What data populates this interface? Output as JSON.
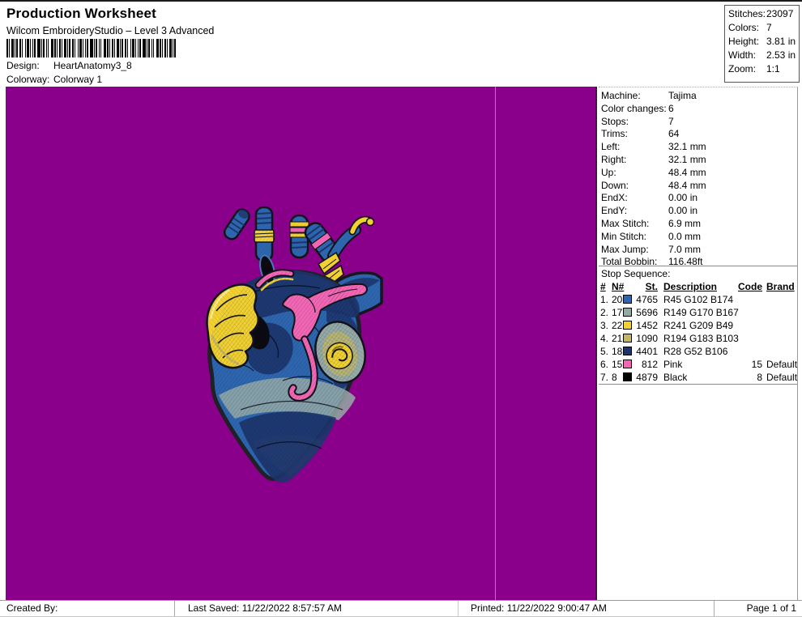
{
  "header": {
    "title": "Production Worksheet",
    "subtitle": "Wilcom EmbroideryStudio – Level 3 Advanced",
    "design_label": "Design:",
    "design_value": "HeartAnatomy3_8",
    "colorway_label": "Colorway:",
    "colorway_value": "Colorway 1",
    "barcode_icon": "barcode"
  },
  "summary": {
    "rows": [
      {
        "label": "Stitches:",
        "value": "23097"
      },
      {
        "label": "Colors:",
        "value": "7"
      },
      {
        "label": "Height:",
        "value": "3.81 in"
      },
      {
        "label": "Width:",
        "value": "2.53 in"
      },
      {
        "label": "Zoom:",
        "value": "1:1"
      }
    ]
  },
  "machine_info": {
    "rows": [
      {
        "label": "Machine:",
        "value": "Tajima"
      },
      {
        "label": "Color changes:",
        "value": "6"
      },
      {
        "label": "Stops:",
        "value": "7"
      },
      {
        "label": "Trims:",
        "value": "64"
      },
      {
        "label": "Left:",
        "value": "32.1 mm"
      },
      {
        "label": "Right:",
        "value": "32.1 mm"
      },
      {
        "label": "Up:",
        "value": "48.4 mm"
      },
      {
        "label": "Down:",
        "value": "48.4 mm"
      },
      {
        "label": "EndX:",
        "value": "0.00 in"
      },
      {
        "label": "EndY:",
        "value": "0.00 in"
      },
      {
        "label": "Max Stitch:",
        "value": "6.9 mm"
      },
      {
        "label": "Min Stitch:",
        "value": "0.0 mm"
      },
      {
        "label": "Max Jump:",
        "value": "7.0 mm"
      },
      {
        "label": "Total Bobbin:",
        "value": "116.48ft"
      }
    ]
  },
  "stop_sequence": {
    "title": "Stop Sequence:",
    "columns": [
      "#",
      "N#",
      "St.",
      "Description",
      "Code",
      "Brand"
    ],
    "rows": [
      {
        "num": "1.",
        "n": "20",
        "swatch": "#2D66AE",
        "st": "4765",
        "description": "R45 G102 B174",
        "code": "",
        "brand": ""
      },
      {
        "num": "2.",
        "n": "17",
        "swatch": "#95AAA7",
        "st": "5696",
        "description": "R149 G170 B167",
        "code": "",
        "brand": ""
      },
      {
        "num": "3.",
        "n": "22",
        "swatch": "#F1D131",
        "st": "1452",
        "description": "R241 G209 B49",
        "code": "",
        "brand": ""
      },
      {
        "num": "4.",
        "n": "21",
        "swatch": "#C2B767",
        "st": "1090",
        "description": "R194 G183 B103",
        "code": "",
        "brand": ""
      },
      {
        "num": "5.",
        "n": "18",
        "swatch": "#1C346A",
        "st": "4401",
        "description": "R28 G52 B106",
        "code": "",
        "brand": ""
      },
      {
        "num": "6.",
        "n": "15",
        "swatch": "#F266B4",
        "st": "812",
        "description": "Pink",
        "code": "15",
        "brand": "Default"
      },
      {
        "num": "7.",
        "n": "8",
        "swatch": "#000000",
        "st": "4879",
        "description": "Black",
        "code": "8",
        "brand": "Default"
      }
    ]
  },
  "canvas": {
    "background": "#8B008B",
    "design_name": "anatomical-heart-embroidery",
    "thread_colors": [
      "#2D66AE",
      "#95AAA7",
      "#F1D131",
      "#C2B767",
      "#1C346A",
      "#F266B4",
      "#000000"
    ]
  },
  "footer": {
    "created_by": "Created By:",
    "last_saved": "Last Saved: 11/22/2022 8:57:57 AM",
    "printed": "Printed: 11/22/2022 9:00:47 AM",
    "page": "Page 1 of 1"
  }
}
